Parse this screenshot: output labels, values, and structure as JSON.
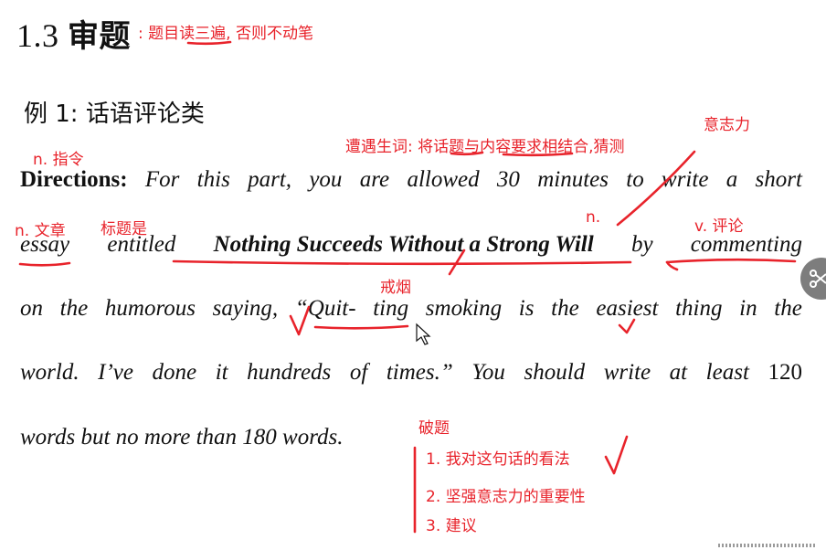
{
  "heading": {
    "number": "1.3",
    "text": "审题"
  },
  "example_title": "例 1: 话语评论类",
  "passage": {
    "directions_label": "Directions:",
    "line1": [
      "For",
      "this",
      "part,",
      "you",
      "are",
      "allowed",
      "30",
      "minutes",
      "to",
      "write",
      "a",
      "short"
    ],
    "line2_essay": "essay",
    "line2_entitled": "entitled",
    "line2_title": "Nothing Succeeds Without a Strong Will",
    "line2_by": "by",
    "line2_commenting": "commenting",
    "line3": [
      "on",
      "the",
      "humorous",
      "saying,",
      "“Quit-",
      "ting",
      "smoking",
      "is",
      "the",
      "easiest",
      "thing",
      "in",
      "the"
    ],
    "line4": [
      "world.",
      "I’ve",
      "done",
      "it",
      "hundreds",
      "of",
      "times.”",
      "You",
      "should",
      "write",
      "at",
      "least",
      "120"
    ],
    "line5": "words but no more than 180 words."
  },
  "annotations": {
    "heading_note": ": 题目读三遍, 否则不动笔",
    "n_directive": "n. 指令",
    "vocab_note": "遭遇生词: 将话题与内容要求相结合,猜测",
    "willpower": "意志力",
    "n_essay": "n. 文章",
    "title_is": "标题是",
    "n_short": "n.",
    "v_comment": "v. 评论",
    "quit_smoking": "戒烟",
    "breakdown_label": "破题",
    "points": [
      "1. 我对这句话的看法",
      "2. 坚强意志力的重要性",
      "3. 建议"
    ]
  },
  "colors": {
    "ink": "#e8232b",
    "text": "#111111",
    "tool_bg": "#7d7d7d"
  },
  "icons": [
    "scissors-icon",
    "mouse-cursor-icon"
  ]
}
